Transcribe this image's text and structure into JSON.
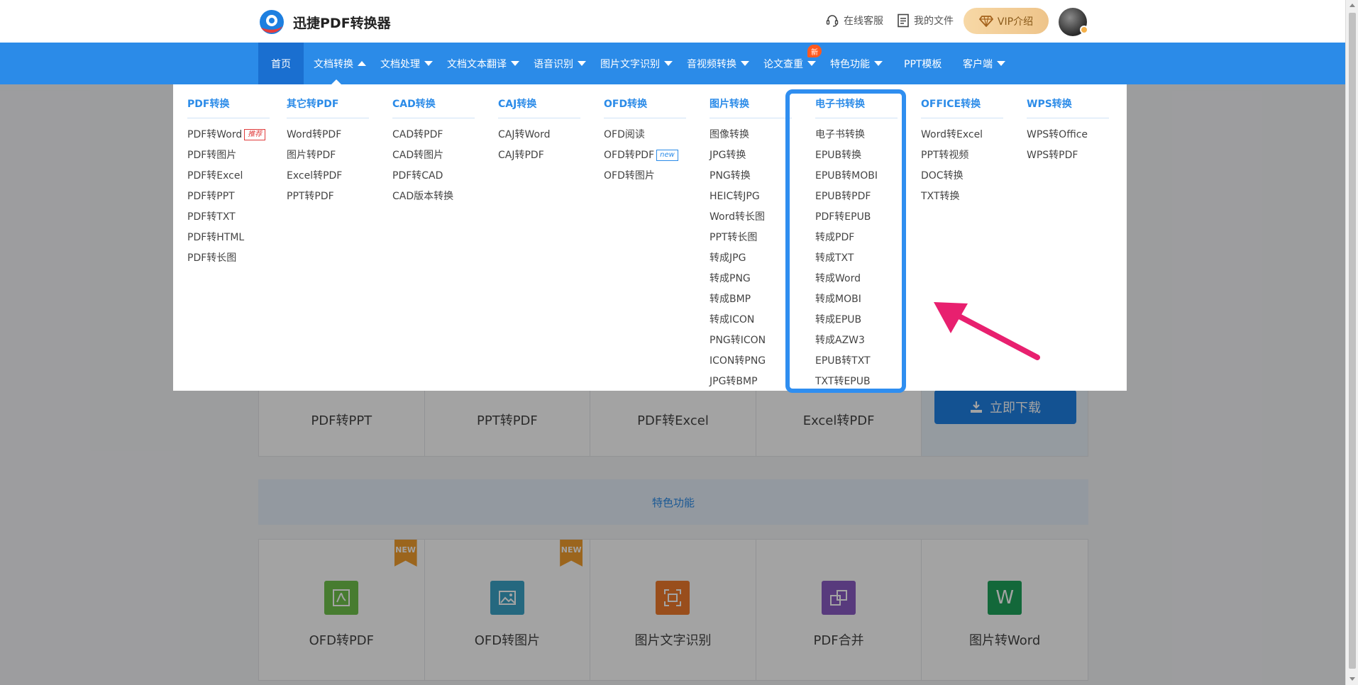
{
  "header": {
    "brand": "迅捷PDF转换器",
    "online_service": "在线客服",
    "my_files": "我的文件",
    "vip_label": "VIP介绍"
  },
  "nav": {
    "items": [
      {
        "label": "首页"
      },
      {
        "label": "文档转换"
      },
      {
        "label": "文档处理"
      },
      {
        "label": "文档文本翻译"
      },
      {
        "label": "语音识别"
      },
      {
        "label": "图片文字识别"
      },
      {
        "label": "音视频转换"
      },
      {
        "label": "论文查重"
      },
      {
        "label": "特色功能"
      },
      {
        "label": "PPT模板"
      },
      {
        "label": "客户端"
      }
    ],
    "new_badge": "新"
  },
  "dropdown": {
    "columns": [
      {
        "title": "PDF转换",
        "items": [
          "PDF转Word",
          "PDF转图片",
          "PDF转Excel",
          "PDF转PPT",
          "PDF转TXT",
          "PDF转HTML",
          "PDF转长图"
        ],
        "tag_item_0": "推荐"
      },
      {
        "title": "其它转PDF",
        "items": [
          "Word转PDF",
          "图片转PDF",
          "Excel转PDF",
          "PPT转PDF"
        ]
      },
      {
        "title": "CAD转换",
        "items": [
          "CAD转PDF",
          "CAD转图片",
          "PDF转CAD",
          "CAD版本转换"
        ]
      },
      {
        "title": "CAJ转换",
        "items": [
          "CAJ转Word",
          "CAJ转PDF"
        ]
      },
      {
        "title": "OFD转换",
        "items": [
          "OFD阅读",
          "OFD转PDF",
          "OFD转图片"
        ],
        "tag_item_1": "new"
      },
      {
        "title": "图片转换",
        "items": [
          "图像转换",
          "JPG转换",
          "PNG转换",
          "HEIC转JPG",
          "Word转长图",
          "PPT转长图",
          "转成JPG",
          "转成PNG",
          "转成BMP",
          "转成ICON",
          "PNG转ICON",
          "ICON转PNG",
          "JPG转BMP"
        ]
      },
      {
        "title": "电子书转换",
        "items": [
          "电子书转换",
          "EPUB转换",
          "EPUB转MOBI",
          "EPUB转PDF",
          "PDF转EPUB",
          "转成PDF",
          "转成TXT",
          "转成Word",
          "转成MOBI",
          "转成EPUB",
          "转成AZW3",
          "EPUB转TXT",
          "TXT转EPUB"
        ]
      },
      {
        "title": "OFFICE转换",
        "items": [
          "Word转Excel",
          "PPT转视频",
          "DOC转换",
          "TXT转换"
        ]
      },
      {
        "title": "WPS转换",
        "items": [
          "WPS转Office",
          "WPS转PDF"
        ]
      }
    ]
  },
  "background": {
    "tools": [
      "PDF转PPT",
      "PPT转PDF",
      "PDF转Excel",
      "Excel转PDF"
    ],
    "download_label": "立即下载",
    "feature_title": "特色功能",
    "features": [
      {
        "label": "OFD转PDF",
        "icon": "ofd-pdf-icon",
        "color": "#6fc24b",
        "ribbon": "NEW"
      },
      {
        "label": "OFD转图片",
        "icon": "ofd-image-icon",
        "color": "#3aa3c7",
        "ribbon": "NEW"
      },
      {
        "label": "图片文字识别",
        "icon": "ocr-icon",
        "color": "#f07a2c",
        "ribbon": ""
      },
      {
        "label": "PDF合并",
        "icon": "merge-icon",
        "color": "#8a5bc4",
        "ribbon": ""
      },
      {
        "label": "图片转Word",
        "icon": "word-icon",
        "color": "#1fa35b",
        "ribbon": "",
        "glyph": "W"
      }
    ]
  },
  "colors": {
    "nav_blue": "#2b8be8",
    "highlight": "#2f8ef0",
    "annotation_arrow": "#e8206f"
  }
}
